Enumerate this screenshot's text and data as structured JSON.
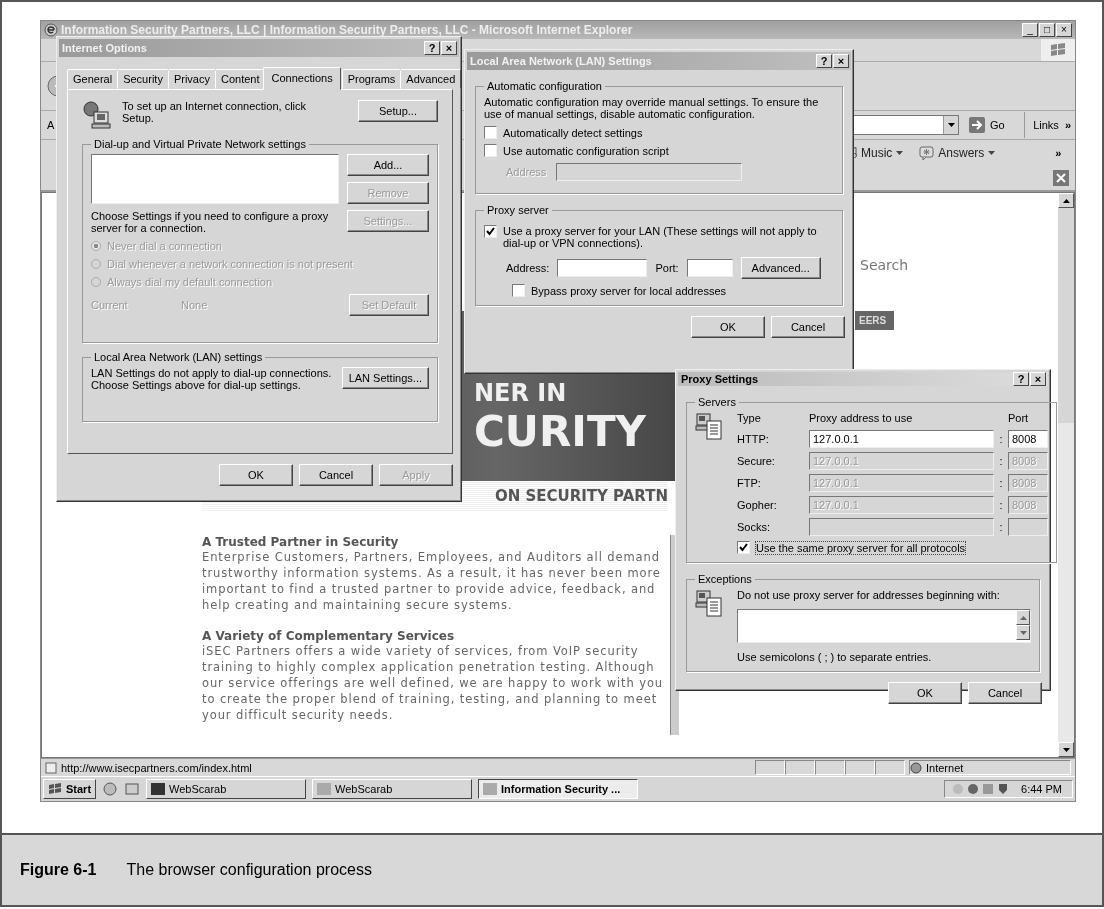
{
  "browser": {
    "title": "Information Security Partners, LLC | Information Security Partners, LLC - Microsoft Internet Explorer",
    "window_buttons": [
      "_",
      "□",
      "×"
    ],
    "address_label": "A",
    "go": "Go",
    "links": "Links",
    "links_more": "»",
    "toolbar_links": [
      {
        "label": "Music"
      },
      {
        "label": "Answers"
      }
    ],
    "toolbar_more": "»",
    "page": {
      "search": "Search",
      "tab": "EERS",
      "banner_lines": [
        "NER IN",
        "CURITY"
      ],
      "tagline": "ON SECURITY PARTN",
      "sections": [
        {
          "heading": "A Trusted Partner in Security",
          "body": "Enterprise Customers, Partners, Employees, and Auditors all demand trustworthy information systems. As a result, it has never been more important to find a trusted partner to provide advice, feedback, and help creating and maintaining secure systems."
        },
        {
          "heading": "A Variety of Complementary Services",
          "body": "iSEC Partners offers a wide variety of services, from VoIP security training to highly complex application penetration testing. Although our service offerings are well defined, we are happy to work with you to create the proper blend of training, testing, and planning to meet your difficult security needs."
        }
      ]
    },
    "status": {
      "url": "http://www.isecpartners.com/index.html",
      "zone": "Internet"
    }
  },
  "taskbar": {
    "start": "Start",
    "tasks": [
      {
        "label": "WebScarab",
        "selected": false
      },
      {
        "label": "WebScarab",
        "selected": false
      },
      {
        "label": "Information Security ...",
        "selected": true
      }
    ],
    "clock": "6:44 PM"
  },
  "internet_options": {
    "title": "Internet Options",
    "active": false,
    "help": "?",
    "close": "×",
    "tabs": [
      {
        "label": "General",
        "selected": false
      },
      {
        "label": "Security",
        "selected": false
      },
      {
        "label": "Privacy",
        "selected": false
      },
      {
        "label": "Content",
        "selected": false
      },
      {
        "label": "Connections",
        "selected": true
      },
      {
        "label": "Programs",
        "selected": false
      },
      {
        "label": "Advanced",
        "selected": false
      }
    ],
    "setup_text": "To set up an Internet connection, click Setup.",
    "setup_button": "Setup...",
    "dialup": {
      "legend": "Dial-up and Virtual Private Network settings",
      "buttons": [
        {
          "label": "Add...",
          "disabled": false
        },
        {
          "label": "Remove",
          "disabled": true
        },
        {
          "label": "Settings...",
          "disabled": true
        }
      ],
      "note": "Choose Settings if you need to configure a proxy server for a connection.",
      "radios": [
        {
          "label": "Never dial a connection",
          "selected": true,
          "disabled": true
        },
        {
          "label": "Dial whenever a network connection is not present",
          "selected": false,
          "disabled": true
        },
        {
          "label": "Always dial my default connection",
          "selected": false,
          "disabled": true
        }
      ],
      "current_label": "Current",
      "current_value": "None",
      "current_disabled": true,
      "set_default": {
        "label": "Set Default",
        "disabled": true
      }
    },
    "lan": {
      "legend": "Local Area Network (LAN) settings",
      "text": "LAN Settings do not apply to dial-up connections. Choose Settings above for dial-up settings.",
      "button": "LAN Settings..."
    },
    "buttons": [
      {
        "label": "OK",
        "disabled": false
      },
      {
        "label": "Cancel",
        "disabled": false
      },
      {
        "label": "Apply",
        "disabled": true
      }
    ]
  },
  "lan_settings": {
    "title": "Local Area Network (LAN) Settings",
    "active": false,
    "help": "?",
    "close": "×",
    "auto": {
      "legend": "Automatic configuration",
      "text": "Automatic configuration may override manual settings.  To ensure the use of manual settings, disable automatic configuration.",
      "checkboxes": [
        {
          "label": "Automatically detect settings",
          "checked": false
        },
        {
          "label": "Use automatic configuration script",
          "checked": false
        }
      ],
      "address_label": "Address",
      "address_disabled": true
    },
    "proxy": {
      "legend": "Proxy server",
      "use_proxy": {
        "label": "Use a proxy server for your LAN (These settings will not apply to dial-up or VPN connections).",
        "checked": true
      },
      "address_label": "Address:",
      "port_label": "Port:",
      "advanced": "Advanced...",
      "bypass": {
        "label": "Bypass proxy server for local addresses",
        "checked": false
      }
    },
    "buttons": [
      {
        "label": "OK",
        "disabled": false
      },
      {
        "label": "Cancel",
        "disabled": false
      }
    ]
  },
  "proxy_settings": {
    "title": "Proxy Settings",
    "active": true,
    "help": "?",
    "close": "×",
    "servers": {
      "legend": "Servers",
      "headers": [
        "Type",
        "Proxy address to use",
        "Port"
      ],
      "rows": [
        {
          "type": "HTTP:",
          "address": "127.0.0.1",
          "separator": ":",
          "port": "8008",
          "disabled": false
        },
        {
          "type": "Secure:",
          "address": "127.0.0.1",
          "separator": ":",
          "port": "8008",
          "disabled": true
        },
        {
          "type": "FTP:",
          "address": "127.0.0.1",
          "separator": ":",
          "port": "8008",
          "disabled": true
        },
        {
          "type": "Gopher:",
          "address": "127.0.0.1",
          "separator": ":",
          "port": "8008",
          "disabled": true
        },
        {
          "type": "Socks:",
          "address": "",
          "separator": ":",
          "port": "",
          "disabled": true
        }
      ],
      "same_proxy": {
        "label": "Use the same proxy server for all protocols",
        "checked": true
      }
    },
    "exceptions": {
      "legend": "Exceptions",
      "text": "Do not use proxy server for addresses beginning with:",
      "note": "Use semicolons ( ; ) to separate entries."
    },
    "buttons": [
      {
        "label": "OK",
        "disabled": false
      },
      {
        "label": "Cancel",
        "disabled": false
      }
    ]
  },
  "figure": {
    "number": "Figure 6-1",
    "caption": "The browser configuration process"
  }
}
